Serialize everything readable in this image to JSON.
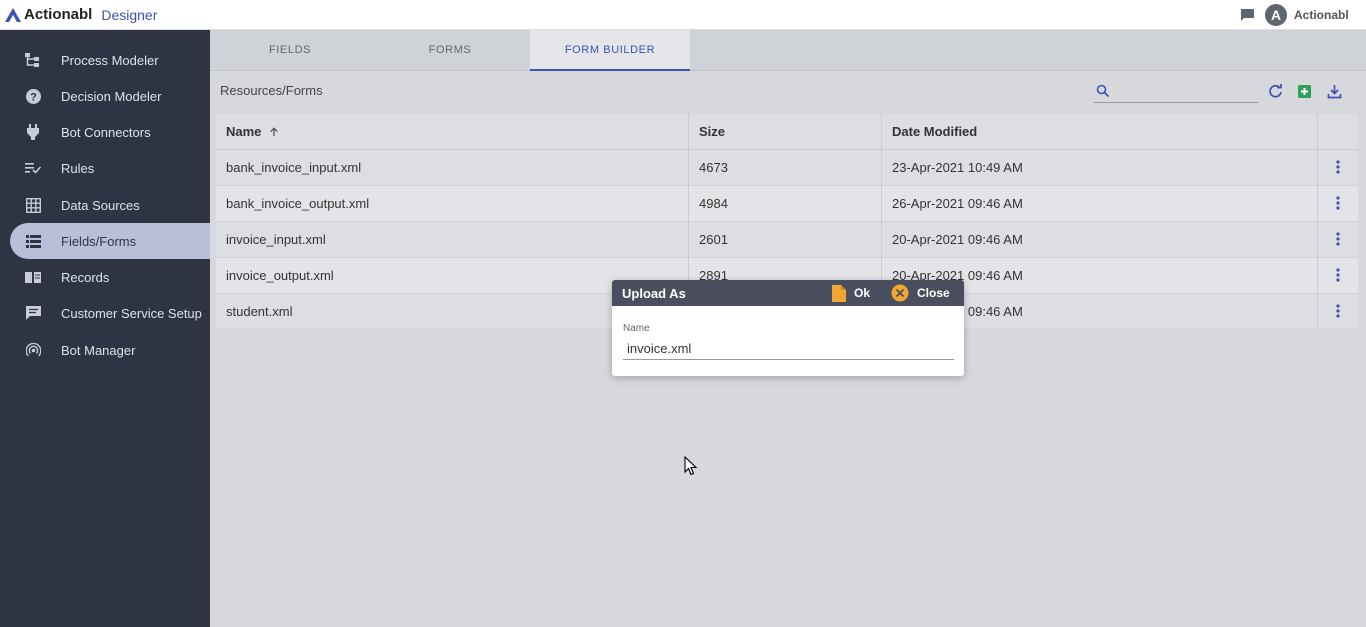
{
  "app": {
    "brand_name": "Actionabl",
    "brand_sub": "Designer",
    "user_initial": "A",
    "user_name": "Actionabl"
  },
  "sidebar": {
    "items": [
      {
        "label": "Process Modeler",
        "icon": "process-modeler-icon"
      },
      {
        "label": "Decision Modeler",
        "icon": "help-circle-icon"
      },
      {
        "label": "Bot Connectors",
        "icon": "plug-icon"
      },
      {
        "label": "Rules",
        "icon": "playlist-check-icon"
      },
      {
        "label": "Data Sources",
        "icon": "grid-icon"
      },
      {
        "label": "Fields/Forms",
        "icon": "list-icon",
        "active": true
      },
      {
        "label": "Records",
        "icon": "book-icon"
      },
      {
        "label": "Customer Service Setup",
        "icon": "chat-icon"
      },
      {
        "label": "Bot Manager",
        "icon": "broadcast-icon"
      }
    ]
  },
  "tabs": [
    {
      "label": "FIELDS"
    },
    {
      "label": "FORMS"
    },
    {
      "label": "FORM BUILDER",
      "active": true
    }
  ],
  "breadcrumb": "Resources/Forms",
  "search": {
    "value": "",
    "placeholder": ""
  },
  "table": {
    "headers": {
      "name": "Name",
      "size": "Size",
      "date": "Date Modified"
    },
    "rows": [
      {
        "name": "bank_invoice_input.xml",
        "size": "4673",
        "date": "23-Apr-2021 10:49 AM"
      },
      {
        "name": "bank_invoice_output.xml",
        "size": "4984",
        "date": "26-Apr-2021 09:46 AM"
      },
      {
        "name": "invoice_input.xml",
        "size": "2601",
        "date": "20-Apr-2021 09:46 AM"
      },
      {
        "name": "invoice_output.xml",
        "size": "2891",
        "date": "20-Apr-2021 09:46 AM"
      },
      {
        "name": "student.xml",
        "size": "",
        "date": "20-Apr-2021 09:46 AM"
      }
    ]
  },
  "dialog": {
    "title": "Upload As",
    "ok_label": "Ok",
    "close_label": "Close",
    "field_label": "Name",
    "field_value": "invoice.xml"
  },
  "colors": {
    "accent": "#3f51b5",
    "sidebar_bg": "#2e3444",
    "active_item_bg": "#b7bfd9",
    "dialog_header": "#4a4e5e",
    "ok_icon": "#f0a830",
    "close_icon": "#f0a830"
  }
}
